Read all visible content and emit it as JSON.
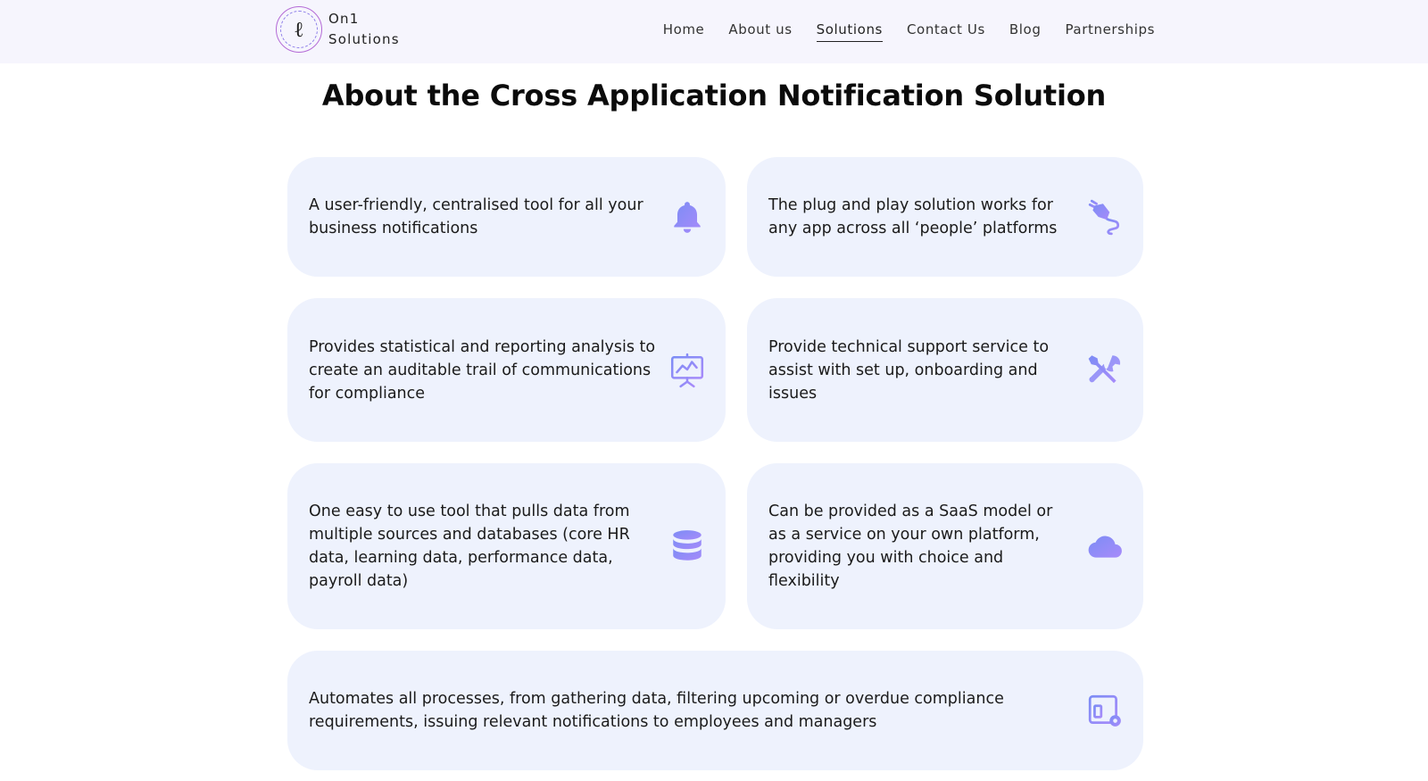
{
  "brand": {
    "line1": "On1",
    "line2": "Solutions",
    "logo_glyph": "ℓ"
  },
  "nav": [
    {
      "label": "Home"
    },
    {
      "label": "About us"
    },
    {
      "label": "Solutions",
      "active": true
    },
    {
      "label": "Contact Us"
    },
    {
      "label": "Blog"
    },
    {
      "label": "Partnerships"
    }
  ],
  "page": {
    "title": "About the Cross Application Notification Solution"
  },
  "features": [
    {
      "text": "A user-friendly, centralised tool for all your business notifications",
      "icon": "bell-icon"
    },
    {
      "text": "The plug and play solution works for any app across all ‘people’ platforms",
      "icon": "plug-icon"
    },
    {
      "text": "Provides statistical and reporting analysis to create an auditable trail of communications for compliance",
      "icon": "presentation-chart-icon"
    },
    {
      "text": "Provide technical support service to assist with set up, onboarding and issues",
      "icon": "tools-icon"
    },
    {
      "text": "One easy to use tool that pulls data from multiple sources and databases (core HR data, learning data, performance data, payroll data)",
      "icon": "database-icon"
    },
    {
      "text": "Can be provided as a SaaS model or as a service on your own platform, providing you with choice and flexibility",
      "icon": "cloud-icon"
    },
    {
      "text": "Automates all processes, from gathering data, filtering upcoming or overdue compliance requirements, issuing relevant notifications to employees and managers",
      "icon": "settings-window-icon"
    }
  ],
  "colors": {
    "icon_gradient_start": "#7c8cf5",
    "icon_gradient_end": "#a78bfa",
    "card_background": "#eef2fd",
    "header_background": "#f6f5fd"
  }
}
